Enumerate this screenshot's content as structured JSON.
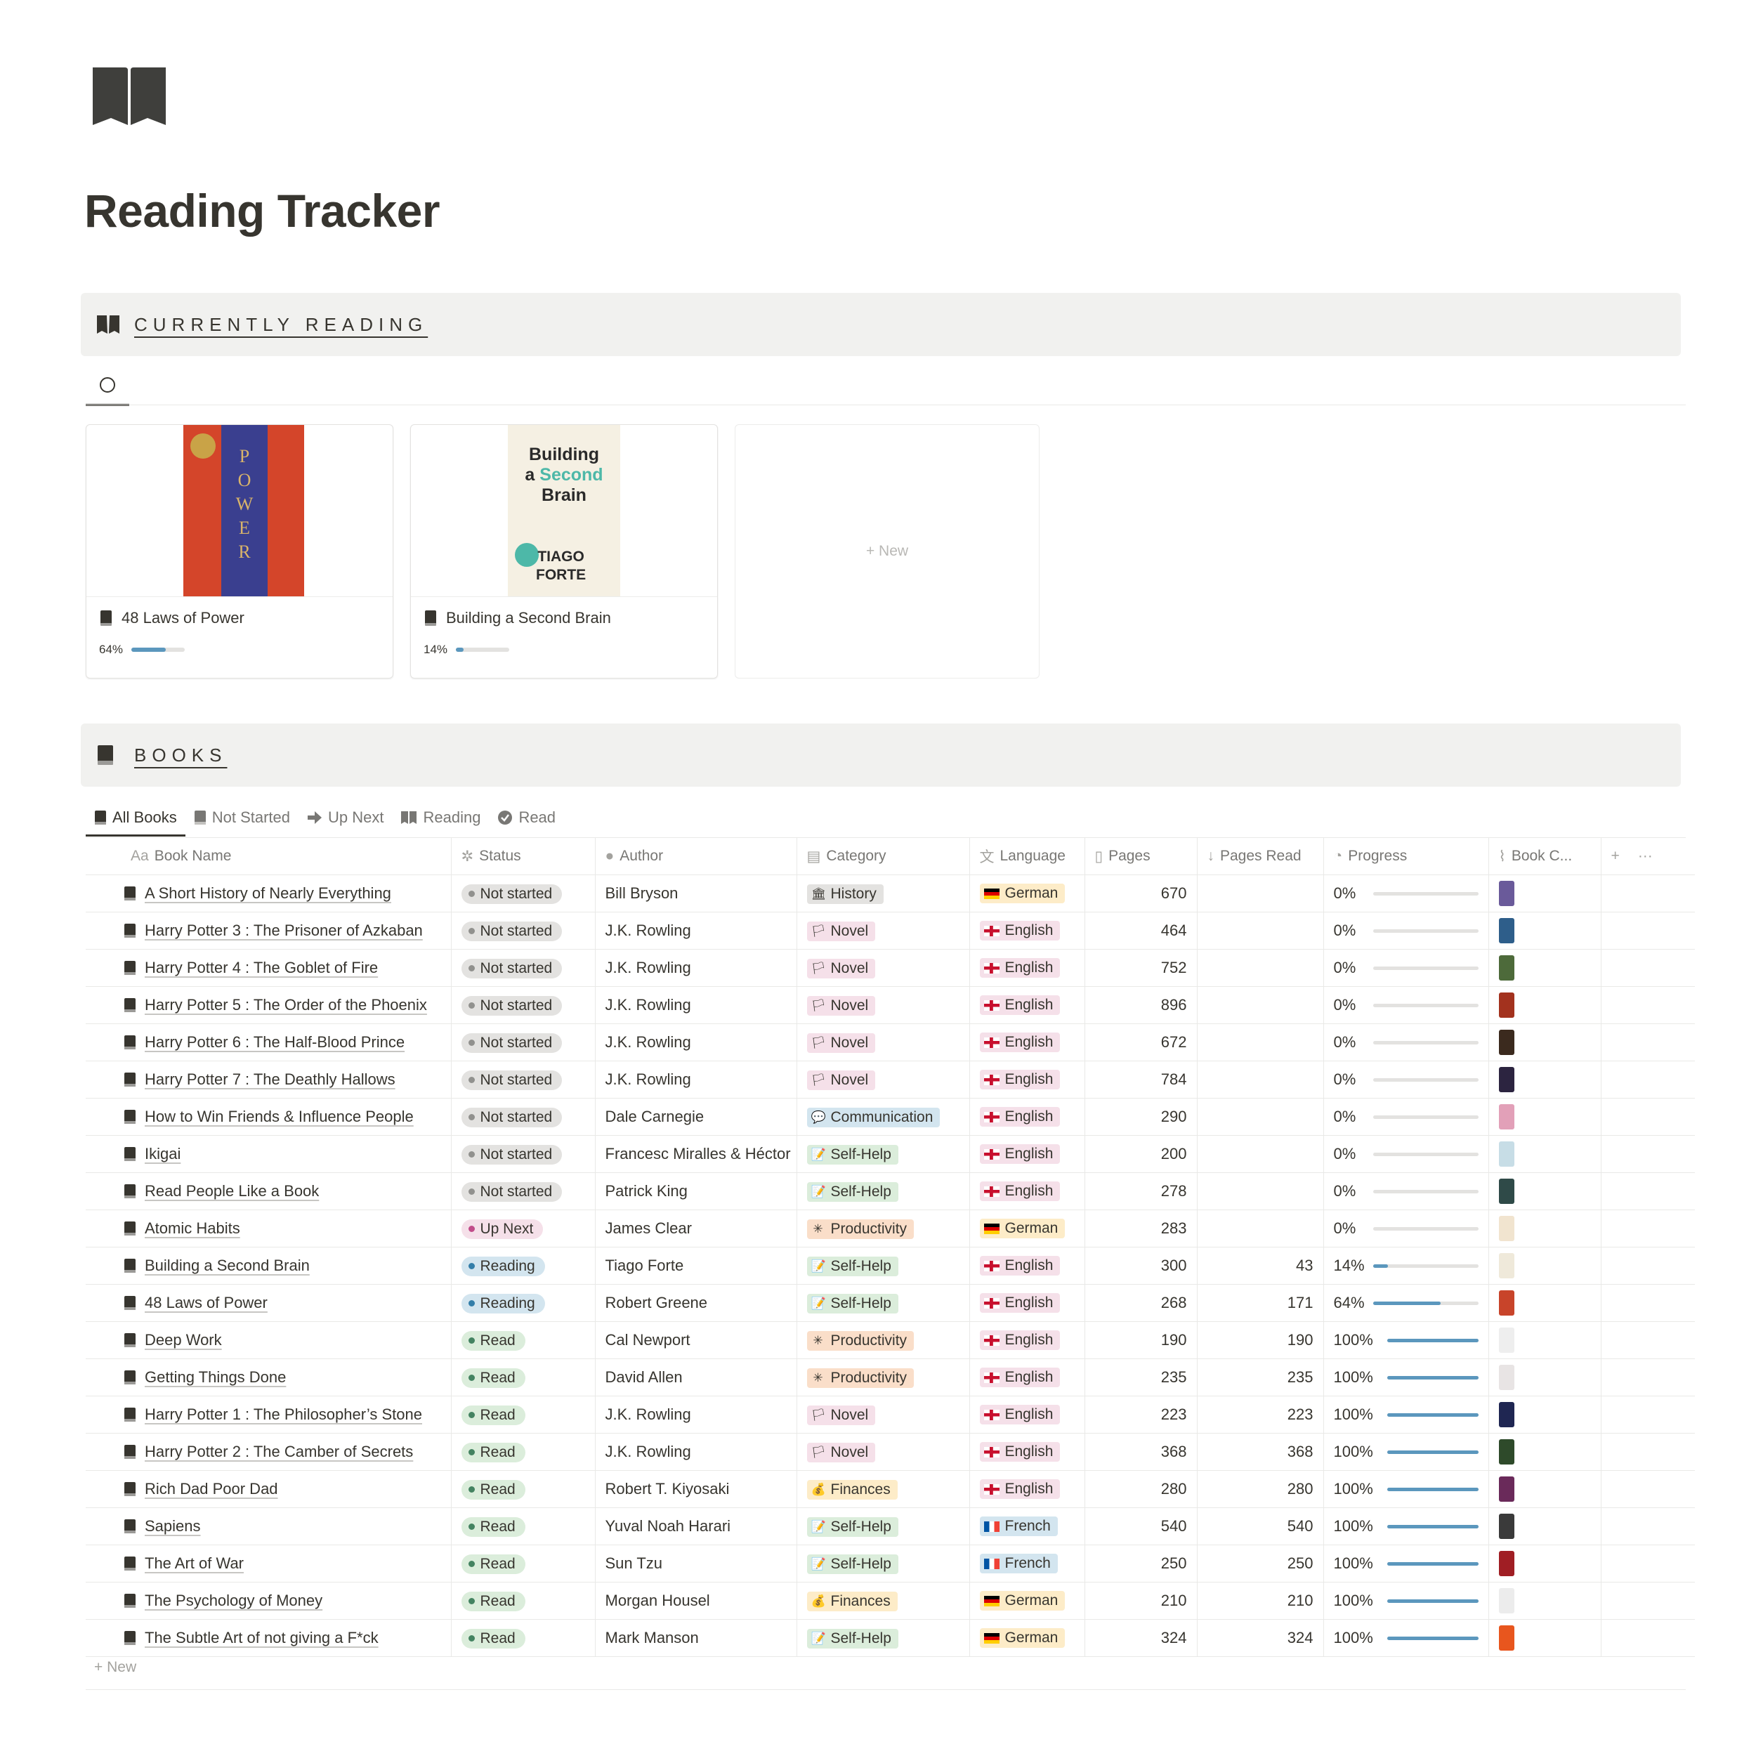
{
  "page": {
    "title": "Reading Tracker",
    "icon": "open-book-icon"
  },
  "currently_reading": {
    "heading": "CURRENTLY READING",
    "new_label": "+ New",
    "cards": [
      {
        "title": "48 Laws of Power",
        "progress_label": "64%",
        "progress": 0.64
      },
      {
        "title": "Building a Second Brain",
        "progress_label": "14%",
        "progress": 0.14
      }
    ],
    "covers": {
      "power": {
        "letters": [
          "P",
          "O",
          "W",
          "E",
          "R"
        ]
      },
      "second_brain": {
        "line1": "Building",
        "line2a": "a ",
        "line2b": "Second",
        "line3": "Brain",
        "author1": "TIAGO",
        "author2": "FORTE"
      }
    }
  },
  "books": {
    "heading": "BOOKS",
    "tabs": [
      "All Books",
      "Not Started",
      "Up Next",
      "Reading",
      "Read"
    ],
    "columns": [
      "Book Name",
      "Status",
      "Author",
      "Category",
      "Language",
      "Pages",
      "Pages Read",
      "Progress",
      "Book C..."
    ],
    "column_prefix": "Aa",
    "new_row_label": "+ New",
    "colors": {
      "status": {
        "Not started": {
          "bg": "#e3e2e0",
          "dot": "#91918e"
        },
        "Up Next": {
          "bg": "#f5e0e9",
          "dot": "#c14c8a"
        },
        "Reading": {
          "bg": "#d3e5ef",
          "dot": "#337ea9"
        },
        "Read": {
          "bg": "#dbeddb",
          "dot": "#448361"
        }
      },
      "category": {
        "History": "#e3e2e0",
        "Novel": "#f5e0e9",
        "Communication": "#d3e5ef",
        "Self-Help": "#dbeddb",
        "Productivity": "#fadec9",
        "Finances": "#fdecc8"
      },
      "language": {
        "German": "#fdecc8",
        "English": "#f5e0e9",
        "French": "#d3e5ef"
      }
    },
    "rows": [
      {
        "name": "A Short History of Nearly Everything",
        "status": "Not started",
        "author": "Bill Bryson",
        "category": "History",
        "language": "German",
        "pages": "670",
        "pages_read": "",
        "progress": "0%",
        "progress_value": 0,
        "cover_color": "#6a5a9a"
      },
      {
        "name": "Harry Potter 3 : The Prisoner of Azkaban",
        "status": "Not started",
        "author": "J.K. Rowling",
        "category": "Novel",
        "language": "English",
        "pages": "464",
        "pages_read": "",
        "progress": "0%",
        "progress_value": 0,
        "cover_color": "#2e5e8a"
      },
      {
        "name": "Harry Potter 4 : The Goblet of Fire",
        "status": "Not started",
        "author": "J.K. Rowling",
        "category": "Novel",
        "language": "English",
        "pages": "752",
        "pages_read": "",
        "progress": "0%",
        "progress_value": 0,
        "cover_color": "#4d6a3a"
      },
      {
        "name": "Harry Potter 5 : The Order of the Phoenix",
        "status": "Not started",
        "author": "J.K. Rowling",
        "category": "Novel",
        "language": "English",
        "pages": "896",
        "pages_read": "",
        "progress": "0%",
        "progress_value": 0,
        "cover_color": "#a3321e"
      },
      {
        "name": "Harry Potter 6 : The Half-Blood Prince",
        "status": "Not started",
        "author": "J.K. Rowling",
        "category": "Novel",
        "language": "English",
        "pages": "672",
        "pages_read": "",
        "progress": "0%",
        "progress_value": 0,
        "cover_color": "#3b2a1e"
      },
      {
        "name": "Harry Potter 7 : The Deathly Hallows",
        "status": "Not started",
        "author": "J.K. Rowling",
        "category": "Novel",
        "language": "English",
        "pages": "784",
        "pages_read": "",
        "progress": "0%",
        "progress_value": 0,
        "cover_color": "#2c2440"
      },
      {
        "name": "How to Win Friends & Influence People",
        "status": "Not started",
        "author": "Dale Carnegie",
        "category": "Communication",
        "language": "English",
        "pages": "290",
        "pages_read": "",
        "progress": "0%",
        "progress_value": 0,
        "cover_color": "#e2a0b8"
      },
      {
        "name": "Ikigai",
        "status": "Not started",
        "author": "Francesc Miralles & Héctor",
        "category": "Self-Help",
        "language": "English",
        "pages": "200",
        "pages_read": "",
        "progress": "0%",
        "progress_value": 0,
        "cover_color": "#c7dde6"
      },
      {
        "name": "Read People Like a Book",
        "status": "Not started",
        "author": "Patrick King",
        "category": "Self-Help",
        "language": "English",
        "pages": "278",
        "pages_read": "",
        "progress": "0%",
        "progress_value": 0,
        "cover_color": "#2f4a48"
      },
      {
        "name": "Atomic Habits",
        "status": "Up Next",
        "author": "James Clear",
        "category": "Productivity",
        "language": "German",
        "pages": "283",
        "pages_read": "",
        "progress": "0%",
        "progress_value": 0,
        "cover_color": "#f1e4cf"
      },
      {
        "name": "Building a Second Brain",
        "status": "Reading",
        "author": "Tiago Forte",
        "category": "Self-Help",
        "language": "English",
        "pages": "300",
        "pages_read": "43",
        "progress": "14%",
        "progress_value": 0.14,
        "cover_color": "#efe9da"
      },
      {
        "name": "48 Laws of Power",
        "status": "Reading",
        "author": "Robert Greene",
        "category": "Self-Help",
        "language": "English",
        "pages": "268",
        "pages_read": "171",
        "progress": "64%",
        "progress_value": 0.64,
        "cover_color": "#c8442a"
      },
      {
        "name": "Deep Work",
        "status": "Read",
        "author": "Cal Newport",
        "category": "Productivity",
        "language": "English",
        "pages": "190",
        "pages_read": "190",
        "progress": "100%",
        "progress_value": 1,
        "cover_color": "#eeeeee"
      },
      {
        "name": "Getting Things Done",
        "status": "Read",
        "author": "David Allen",
        "category": "Productivity",
        "language": "English",
        "pages": "235",
        "pages_read": "235",
        "progress": "100%",
        "progress_value": 1,
        "cover_color": "#e8e4e4"
      },
      {
        "name": "Harry Potter 1 : The Philosopher’s Stone",
        "status": "Read",
        "author": "J.K. Rowling",
        "category": "Novel",
        "language": "English",
        "pages": "223",
        "pages_read": "223",
        "progress": "100%",
        "progress_value": 1,
        "cover_color": "#1f2652"
      },
      {
        "name": "Harry Potter 2 : The Camber of Secrets",
        "status": "Read",
        "author": "J.K. Rowling",
        "category": "Novel",
        "language": "English",
        "pages": "368",
        "pages_read": "368",
        "progress": "100%",
        "progress_value": 1,
        "cover_color": "#2e4a2a"
      },
      {
        "name": "Rich Dad Poor Dad",
        "status": "Read",
        "author": "Robert T. Kiyosaki",
        "category": "Finances",
        "language": "English",
        "pages": "280",
        "pages_read": "280",
        "progress": "100%",
        "progress_value": 1,
        "cover_color": "#6a2a5a"
      },
      {
        "name": "Sapiens",
        "status": "Read",
        "author": "Yuval Noah Harari",
        "category": "Self-Help",
        "language": "French",
        "pages": "540",
        "pages_read": "540",
        "progress": "100%",
        "progress_value": 1,
        "cover_color": "#3a3a3a"
      },
      {
        "name": "The Art of War",
        "status": "Read",
        "author": "Sun Tzu",
        "category": "Self-Help",
        "language": "French",
        "pages": "250",
        "pages_read": "250",
        "progress": "100%",
        "progress_value": 1,
        "cover_color": "#a01e24"
      },
      {
        "name": "The Psychology of Money",
        "status": "Read",
        "author": "Morgan Housel",
        "category": "Finances",
        "language": "German",
        "pages": "210",
        "pages_read": "210",
        "progress": "100%",
        "progress_value": 1,
        "cover_color": "#ececec"
      },
      {
        "name": "The Subtle Art of not giving a F*ck",
        "status": "Read",
        "author": "Mark Manson",
        "category": "Self-Help",
        "language": "German",
        "pages": "324",
        "pages_read": "324",
        "progress": "100%",
        "progress_value": 1,
        "cover_color": "#e8561e"
      }
    ]
  }
}
